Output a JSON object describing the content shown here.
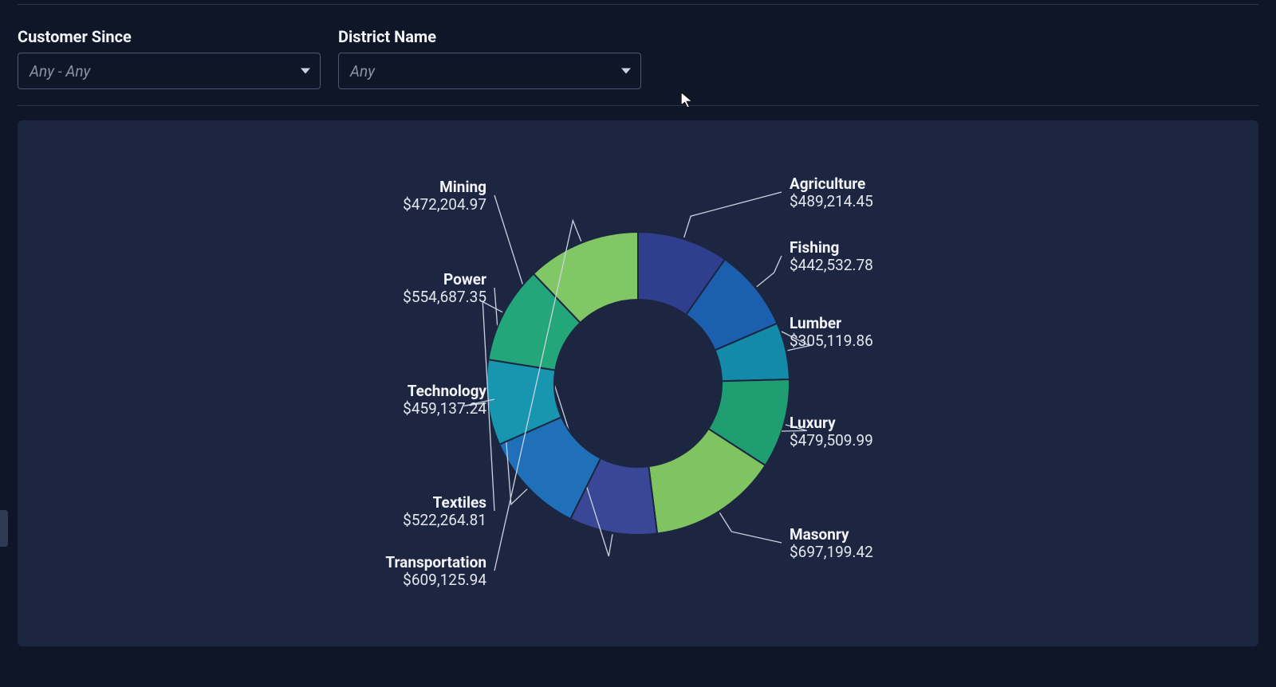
{
  "filters": {
    "customer_since": {
      "label": "Customer Since",
      "value": "Any - Any"
    },
    "district_name": {
      "label": "District Name",
      "value": "Any"
    }
  },
  "chart_data": {
    "type": "pie",
    "donut": true,
    "title": "",
    "series": [
      {
        "name": "Agriculture",
        "value": 489214.45,
        "value_label": "$489,214.45",
        "color": "#2f3e8f"
      },
      {
        "name": "Fishing",
        "value": 442532.78,
        "value_label": "$442,532.78",
        "color": "#1b5fae"
      },
      {
        "name": "Lumber",
        "value": 305119.86,
        "value_label": "$305,119.86",
        "color": "#128aa8"
      },
      {
        "name": "Luxury",
        "value": 479509.99,
        "value_label": "$479,509.99",
        "color": "#1f9e72"
      },
      {
        "name": "Masonry",
        "value": 697199.42,
        "value_label": "$697,199.42",
        "color": "#7fc461"
      },
      {
        "name": "Mining",
        "value": 472204.97,
        "value_label": "$472,204.97",
        "color": "#3a4796"
      },
      {
        "name": "Power",
        "value": 554687.35,
        "value_label": "$554,687.35",
        "color": "#1f6fb9"
      },
      {
        "name": "Technology",
        "value": 459137.24,
        "value_label": "$459,137.24",
        "color": "#1896af"
      },
      {
        "name": "Textiles",
        "value": 522264.81,
        "value_label": "$522,264.81",
        "color": "#23a67a"
      },
      {
        "name": "Transportation",
        "value": 609125.94,
        "value_label": "$609,125.94",
        "color": "#82c765"
      }
    ]
  }
}
